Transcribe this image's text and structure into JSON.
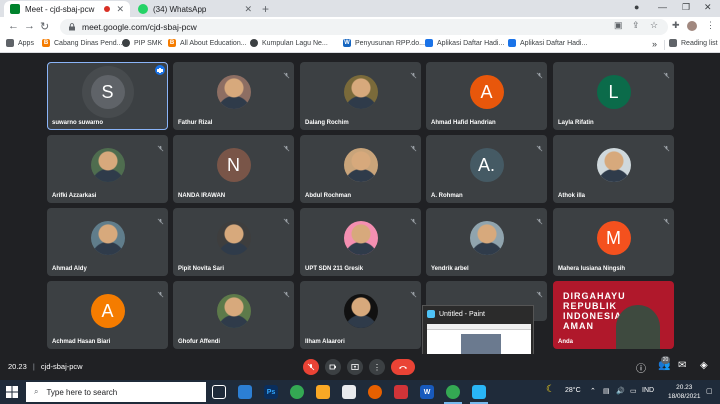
{
  "browser": {
    "tabs": [
      {
        "label": "Meet - cjd-sbaj-pcw",
        "color": "#00832d"
      },
      {
        "label": "(34) WhatsApp",
        "color": "#25d366"
      }
    ],
    "url": "meet.google.com/cjd-sbaj-pcw",
    "bookmarks": [
      {
        "label": "Apps",
        "icon": "apps-icon",
        "color": "#5f6368"
      },
      {
        "label": "Cabang Dinas Pend...",
        "icon": "blogger-icon",
        "color": "#f57c00"
      },
      {
        "label": "PIP SMK",
        "icon": "globe-icon",
        "color": "#3c4043"
      },
      {
        "label": "All About Education...",
        "icon": "blogger-icon",
        "color": "#f57c00"
      },
      {
        "label": "Kumpulan Lagu Ne...",
        "icon": "globe-icon",
        "color": "#3c4043"
      },
      {
        "label": "Penyusunan RPP.do...",
        "icon": "wordpress-icon",
        "color": "#1565c0"
      },
      {
        "label": "Aplikasi Daftar Hadi...",
        "icon": "drive-icon",
        "color": "#1a73e8"
      },
      {
        "label": "Aplikasi Daftar Hadi...",
        "icon": "drive-icon",
        "color": "#1a73e8"
      }
    ],
    "overflow": "»",
    "reading_list": "Reading list"
  },
  "participants": [
    {
      "name": "suwarno suwarno",
      "initial": "S",
      "color": "#5f6368",
      "photo": false
    },
    {
      "name": "Fathur Rizal",
      "initial": "",
      "color": "#8d6e63",
      "photo": true
    },
    {
      "name": "Dalang Rochim",
      "initial": "",
      "color": "#7a6a3a",
      "photo": true
    },
    {
      "name": "Ahmad Hafid Handrian",
      "initial": "A",
      "color": "#e8570b",
      "photo": false
    },
    {
      "name": "Layla Rifatin",
      "initial": "L",
      "color": "#0b6b4a",
      "photo": false
    },
    {
      "name": "Arifki Azzarkasi",
      "initial": "",
      "color": "#4f6d4f",
      "photo": true
    },
    {
      "name": "NANDA IRAWAN",
      "initial": "N",
      "color": "#795548",
      "photo": false
    },
    {
      "name": "Abdul Rochman",
      "initial": "",
      "color": "#c9a47a",
      "photo": true
    },
    {
      "name": "A. Rohman",
      "initial": "A.",
      "color": "#455a64",
      "photo": false
    },
    {
      "name": "Athok illa",
      "initial": "",
      "color": "#cfd8dc",
      "photo": true
    },
    {
      "name": "Ahmad Aldy",
      "initial": "",
      "color": "#607d8b",
      "photo": true
    },
    {
      "name": "Pipit Novita Sari",
      "initial": "",
      "color": "#3e3e3e",
      "photo": true
    },
    {
      "name": "UPT SDN 211 Gresik",
      "initial": "",
      "color": "#f48fb1",
      "photo": true
    },
    {
      "name": "Yendrik arbel",
      "initial": "",
      "color": "#90a4ae",
      "photo": true
    },
    {
      "name": "Mahera lusiana Ningsih",
      "initial": "M",
      "color": "#f4511e",
      "photo": false
    },
    {
      "name": "Achmad Hasan Biari",
      "initial": "A",
      "color": "#f57c00",
      "photo": false
    },
    {
      "name": "Ghofur Affendi",
      "initial": "",
      "color": "#5d7a4a",
      "photo": true
    },
    {
      "name": "Ilham Alaarori",
      "initial": "",
      "color": "#111111",
      "photo": true
    },
    {
      "name": "",
      "initial": "",
      "color": "#3c4043",
      "photo": false
    },
    {
      "name": "Anda",
      "initial": "",
      "color": "#b0182b",
      "photo": false
    }
  ],
  "banner": {
    "line1": "DIRGAHAYU",
    "line2": "REPUBLIK",
    "line3": "INDONESIA",
    "line4": "AMAN"
  },
  "paint": {
    "title": "Untitled - Paint"
  },
  "meeting": {
    "time": "20.23",
    "separator": "|",
    "code": "cjd-sbaj-pcw",
    "people_count": "20"
  },
  "taskbar": {
    "search_placeholder": "Type here to search",
    "temperature": "28°C",
    "language": "IND",
    "time": "20.23",
    "date": "18/08/2021"
  }
}
